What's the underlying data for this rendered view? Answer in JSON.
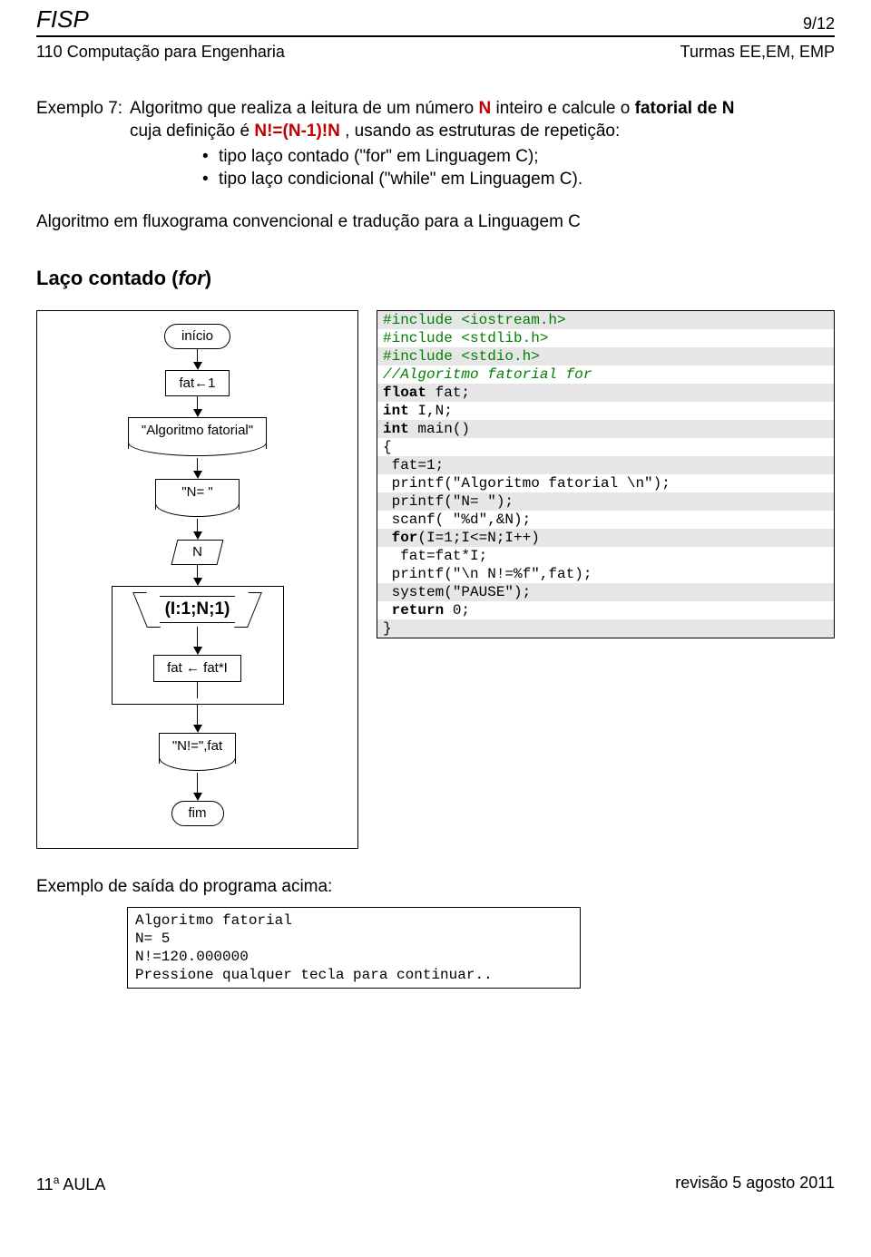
{
  "header": {
    "brand": "FISP",
    "page": "9/12",
    "course": "110 Computação para Engenharia",
    "turmas": "Turmas EE,EM, EMP"
  },
  "example": {
    "label": "Exemplo 7:",
    "intro_a": "Algoritmo que realiza a leitura de um número ",
    "intro_N": "N",
    "intro_b": " inteiro e calcule o ",
    "intro_fat": "fatorial de N",
    "def_a": "cuja definição é  ",
    "def_expr": "N!=(N-1)!N",
    "def_b": " , usando as estruturas de repetição:",
    "bullet1": "tipo laço contado (\"for\" em Linguagem C);",
    "bullet2": "tipo laço condicional (\"while\" em Linguagem C).",
    "para2": "Algoritmo em fluxograma convencional e tradução para a Linguagem C",
    "subheading_a": "Laço contado (",
    "subheading_b": "for",
    "subheading_c": ")"
  },
  "flow": {
    "inicio": "início",
    "s1": "fat←1",
    "o1": "\"Algoritmo fatorial\"",
    "o2": "\"N= \"",
    "in1": "N",
    "hex": "(I:1;N;1)",
    "s2": "fat ← fat*I",
    "o3": "\"N!=\",fat",
    "fim": "fim"
  },
  "code": {
    "l1": "#include <iostream.h>",
    "l2": "#include <stdlib.h>",
    "l3": "#include <stdio.h>",
    "l4": "//Algoritmo fatorial for",
    "l5a": "float",
    "l5b": " fat;",
    "l6a": "int",
    "l6b": " I,N;",
    "l7a": "int",
    "l7b": " main()",
    "l8": "{",
    "l9": " fat=1;",
    "l10": " printf(\"Algoritmo fatorial \\n\");",
    "l11": " printf(\"N= \");",
    "l12": " scanf( \"%d\",&N);",
    "l13a": " for",
    "l13b": "(I=1;I<=N;I++)",
    "l14": "  fat=fat*I;",
    "l15": "",
    "l16": " printf(\"\\n N!=%f\",fat);",
    "l17": " system(\"PAUSE\");",
    "l18a": " return",
    "l18b": " 0;",
    "l19": "}"
  },
  "output": {
    "label": "Exemplo de saída do programa acima:",
    "l1": "Algoritmo fatorial",
    "l2": "N= 5",
    "l3": "N!=120.000000",
    "l4": "Pressione qualquer tecla para continuar.."
  },
  "footer": {
    "left_a": "11",
    "left_sup": "a",
    "left_b": " AULA",
    "right": "revisão 5 agosto 2011"
  }
}
